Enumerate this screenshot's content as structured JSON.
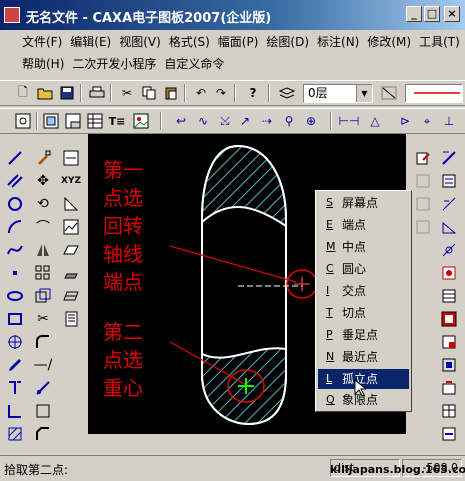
{
  "window": {
    "title": "无名文件 - CAXA电子图板2007(企业版)",
    "controls": [
      "_",
      "□",
      "×"
    ]
  },
  "menu": {
    "row1": [
      "文件(F)",
      "编辑(E)",
      "视图(V)",
      "格式(S)",
      "幅面(P)",
      "绘图(D)",
      "标注(N)",
      "修改(M)",
      "工具(T)"
    ],
    "row2": [
      "帮助(H)",
      "二次开发小程序",
      "自定义命令"
    ]
  },
  "toolbar": {
    "layer_value": "0层"
  },
  "annotations": {
    "first": [
      "第一",
      "点选",
      "回转",
      "轴线",
      "端点"
    ],
    "second": [
      "第二",
      "点选",
      "重心"
    ]
  },
  "context_menu": {
    "items": [
      {
        "key": "S",
        "label": "屏幕点"
      },
      {
        "key": "E",
        "label": "端点"
      },
      {
        "key": "M",
        "label": "中点"
      },
      {
        "key": "C",
        "label": "圆心"
      },
      {
        "key": "I",
        "label": "交点"
      },
      {
        "key": "T",
        "label": "切点"
      },
      {
        "key": "P",
        "label": "垂足点"
      },
      {
        "key": "N",
        "label": "最近点"
      },
      {
        "key": "L",
        "label": "孤立点"
      },
      {
        "key": "Q",
        "label": "象限点"
      }
    ],
    "selected_index": 8
  },
  "status": {
    "prompt": "拾取第二点:",
    "field1": "dist",
    "field2": "-508.0"
  },
  "watermark": "killjapans.blog.163.com",
  "colors": {
    "canvas_bg": "#000000",
    "annotation_text": "#e00000",
    "hatch": "#4fb8c8",
    "selection": "#0a246a"
  }
}
